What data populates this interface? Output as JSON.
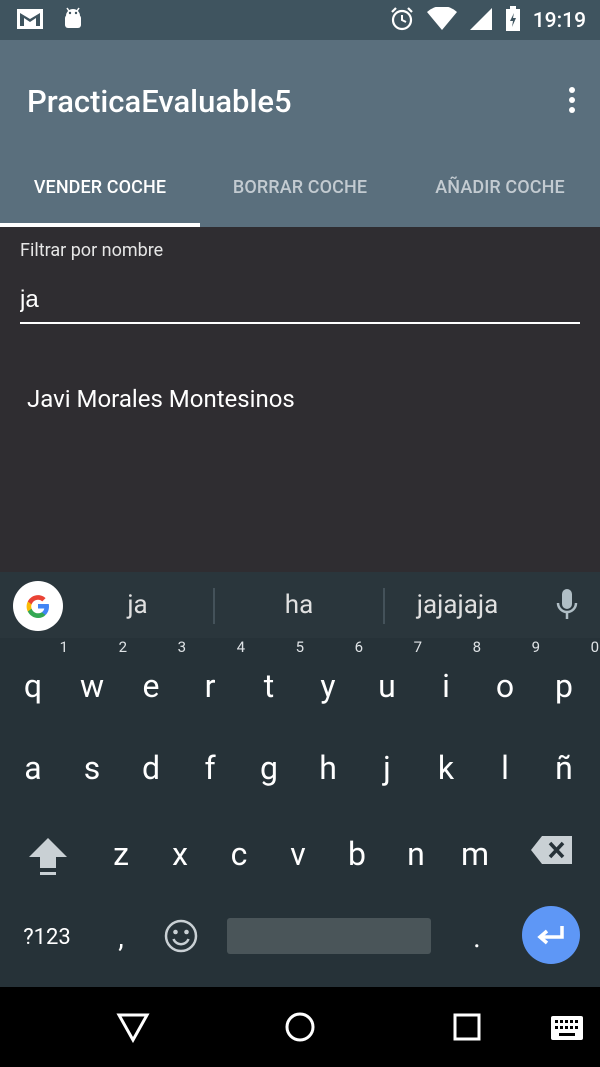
{
  "status_bar": {
    "left_icons": [
      "gmail-icon",
      "android-icon"
    ],
    "right_icons": [
      "alarm-icon",
      "wifi-icon",
      "signal-icon",
      "battery-icon"
    ],
    "time": "19:19"
  },
  "app_bar": {
    "title": "PracticaEvaluable5",
    "menu_icon": "overflow-menu-icon"
  },
  "tabs": [
    {
      "label": "VENDER COCHE",
      "active": true
    },
    {
      "label": "BORRAR COCHE",
      "active": false
    },
    {
      "label": "AÑADIR COCHE",
      "active": false
    }
  ],
  "filter": {
    "label": "Filtrar por nombre",
    "value": "ja"
  },
  "results": [
    "Javi Morales Montesinos"
  ],
  "keyboard": {
    "suggestions": [
      "ja",
      "ha",
      "jajajaja"
    ],
    "row1": [
      "q",
      "w",
      "e",
      "r",
      "t",
      "y",
      "u",
      "i",
      "o",
      "p"
    ],
    "row1_numbers": [
      "1",
      "2",
      "3",
      "4",
      "5",
      "6",
      "7",
      "8",
      "9",
      "0"
    ],
    "row2": [
      "a",
      "s",
      "d",
      "f",
      "g",
      "h",
      "j",
      "k",
      "l",
      "ñ"
    ],
    "row3": [
      "z",
      "x",
      "c",
      "v",
      "b",
      "n",
      "m"
    ],
    "symbols_label": "?123",
    "comma": ",",
    "period": ".",
    "colors": {
      "background": "#263238",
      "enter": "#5e97f6"
    }
  },
  "colors": {
    "status_bar": "#3f545f",
    "app_bar": "#5a6f7d",
    "content_bg": "#2f2d31"
  }
}
